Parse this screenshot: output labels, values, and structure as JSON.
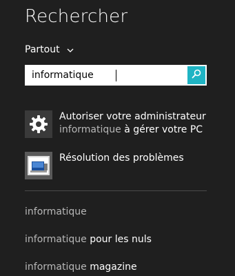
{
  "header": {
    "title": "Rechercher"
  },
  "scope": {
    "label": "Partout"
  },
  "search": {
    "value": "informatique",
    "button_icon": "search-icon"
  },
  "results": [
    {
      "line1": "Autoriser votre administrateur",
      "highlight": "informatique",
      "line2_rest": " à gérer votre PC",
      "icon": "gear-icon"
    },
    {
      "line1": "Résolution des problèmes",
      "icon": "troubleshoot-icon"
    }
  ],
  "suggestions": [
    {
      "highlight": "informatique",
      "rest": ""
    },
    {
      "highlight": "informatique",
      "rest": " pour les nuls"
    },
    {
      "highlight": "informatique",
      "rest": " magazine"
    }
  ],
  "colors": {
    "background": "#1f1f1f",
    "accent": "#1fb4c4",
    "dim_text": "#b8b8b8"
  }
}
